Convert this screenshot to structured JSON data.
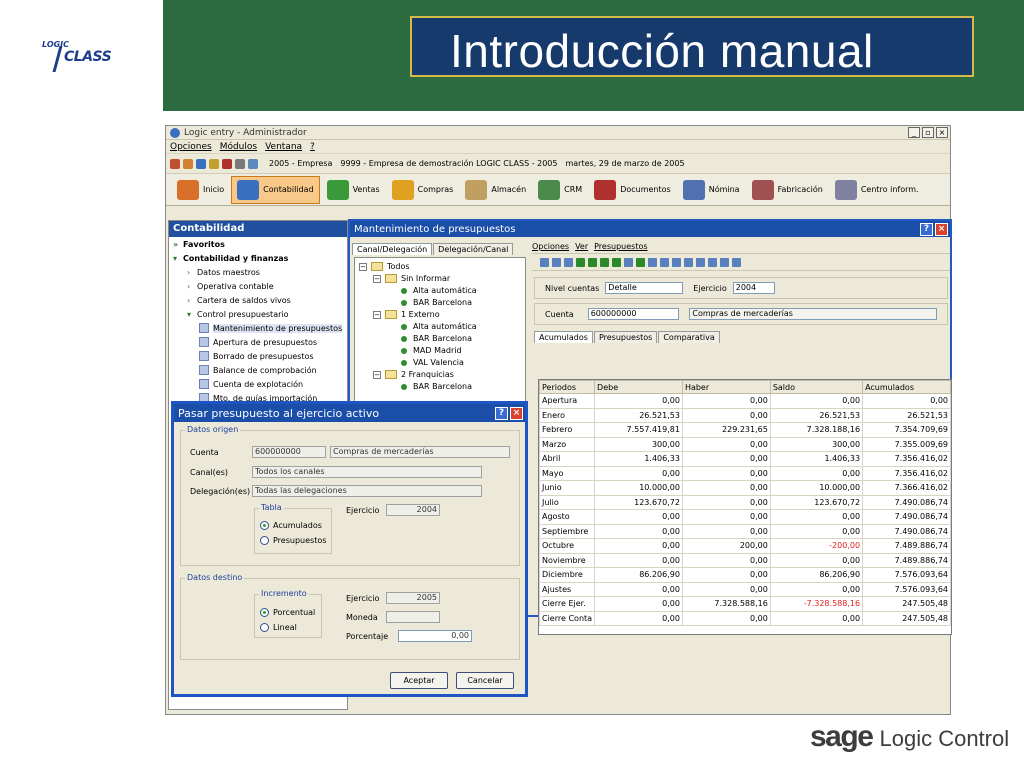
{
  "slide": {
    "title": "Introducción manual",
    "logo_top": "LOGIC",
    "logo_bottom": "CLASS",
    "footer_brand": "sage",
    "footer_product": "Logic Control"
  },
  "app": {
    "window_title": "Logic entry - Administrador",
    "menu": [
      "Opciones",
      "Módulos",
      "Ventana",
      "?"
    ],
    "info_year": "2005 - Empresa",
    "info_company": "9999 - Empresa de demostración LOGIC CLASS - 2005",
    "info_date": "martes, 29 de marzo de 2005",
    "modules": [
      {
        "label": "Inicio",
        "color": "#d9702a"
      },
      {
        "label": "Contabilidad",
        "color": "#3a6fc0"
      },
      {
        "label": "Ventas",
        "color": "#3a9a3a"
      },
      {
        "label": "Compras",
        "color": "#e0a020"
      },
      {
        "label": "Almacén",
        "color": "#c0a060"
      },
      {
        "label": "CRM",
        "color": "#4a8a4a"
      },
      {
        "label": "Documentos",
        "color": "#b03030"
      },
      {
        "label": "Nómina",
        "color": "#5070b0"
      },
      {
        "label": "Fabricación",
        "color": "#a05050"
      },
      {
        "label": "Centro inform.",
        "color": "#8080a0"
      }
    ]
  },
  "nav": {
    "header": "Contabilidad",
    "items": [
      {
        "label": "Favoritos"
      },
      {
        "label": "Contabilidad y finanzas"
      },
      {
        "label": "Datos maestros"
      },
      {
        "label": "Operativa contable"
      },
      {
        "label": "Cartera de saldos vivos"
      },
      {
        "label": "Control presupuestario"
      },
      {
        "label": "Mantenimiento de presupuestos"
      },
      {
        "label": "Apertura de presupuestos"
      },
      {
        "label": "Borrado de presupuestos"
      },
      {
        "label": "Balance de comprobación"
      },
      {
        "label": "Cuenta de explotación"
      },
      {
        "label": "Mto. de guías importación"
      }
    ]
  },
  "mant": {
    "title": "Mantenimiento de presupuestos",
    "tab1": "Canal/Delegación",
    "tab2": "Delegación/Canal",
    "tree": [
      {
        "label": "Todos"
      },
      {
        "label": "Sin Informar"
      },
      {
        "label": "Alta automática"
      },
      {
        "label": "BAR Barcelona"
      },
      {
        "label": "1 Externo"
      },
      {
        "label": "Alta automática"
      },
      {
        "label": "BAR Barcelona"
      },
      {
        "label": "MAD Madrid"
      },
      {
        "label": "VAL Valencia"
      },
      {
        "label": "2 Franquicias"
      },
      {
        "label": "BAR Barcelona"
      }
    ],
    "menu": [
      "Opciones",
      "Ver",
      "Presupuestos"
    ],
    "nivel_label": "Nivel cuentas",
    "nivel_value": "Detalle",
    "ejercicio_label": "Ejercicio",
    "ejercicio_value": "2004",
    "cuenta_label": "Cuenta",
    "cuenta_value": "600000000",
    "cuenta_desc": "Compras de mercaderías",
    "tabs": [
      "Acumulados",
      "Presupuestos",
      "Comparativa"
    ],
    "columns": [
      "Periodos",
      "Debe",
      "Haber",
      "Saldo",
      "Acumulados"
    ],
    "rows": [
      {
        "p": "Apertura",
        "d": "0,00",
        "h": "0,00",
        "s": "0,00",
        "a": "0,00"
      },
      {
        "p": "Enero",
        "d": "26.521,53",
        "h": "0,00",
        "s": "26.521,53",
        "a": "26.521,53"
      },
      {
        "p": "Febrero",
        "d": "7.557.419,81",
        "h": "229.231,65",
        "s": "7.328.188,16",
        "a": "7.354.709,69"
      },
      {
        "p": "Marzo",
        "d": "300,00",
        "h": "0,00",
        "s": "300,00",
        "a": "7.355.009,69"
      },
      {
        "p": "Abril",
        "d": "1.406,33",
        "h": "0,00",
        "s": "1.406,33",
        "a": "7.356.416,02"
      },
      {
        "p": "Mayo",
        "d": "0,00",
        "h": "0,00",
        "s": "0,00",
        "a": "7.356.416,02"
      },
      {
        "p": "Junio",
        "d": "10.000,00",
        "h": "0,00",
        "s": "10.000,00",
        "a": "7.366.416,02"
      },
      {
        "p": "Julio",
        "d": "123.670,72",
        "h": "0,00",
        "s": "123.670,72",
        "a": "7.490.086,74"
      },
      {
        "p": "Agosto",
        "d": "0,00",
        "h": "0,00",
        "s": "0,00",
        "a": "7.490.086,74"
      },
      {
        "p": "Septiembre",
        "d": "0,00",
        "h": "0,00",
        "s": "0,00",
        "a": "7.490.086,74"
      },
      {
        "p": "Octubre",
        "d": "0,00",
        "h": "200,00",
        "s": "-200,00",
        "a": "7.489.886,74"
      },
      {
        "p": "Noviembre",
        "d": "0,00",
        "h": "0,00",
        "s": "0,00",
        "a": "7.489.886,74"
      },
      {
        "p": "Diciembre",
        "d": "86.206,90",
        "h": "0,00",
        "s": "86.206,90",
        "a": "7.576.093,64"
      },
      {
        "p": "Ajustes",
        "d": "0,00",
        "h": "0,00",
        "s": "0,00",
        "a": "7.576.093,64"
      },
      {
        "p": "Cierre Ejer.",
        "d": "0,00",
        "h": "7.328.588,16",
        "s": "-7.328.588,16",
        "a": "247.505,48"
      },
      {
        "p": "Cierre Conta",
        "d": "0,00",
        "h": "0,00",
        "s": "0,00",
        "a": "247.505,48"
      }
    ]
  },
  "dialog": {
    "title": "Pasar presupuesto al ejercicio activo",
    "origen_legend": "Datos origen",
    "cuenta_label": "Cuenta",
    "cuenta_value": "600000000",
    "cuenta_desc": "Compras de mercaderías",
    "canal_label": "Canal(es)",
    "canal_value": "Todos los canales",
    "deleg_label": "Delegación(es)",
    "deleg_value": "Todas las delegaciones",
    "tabla_legend": "Tabla",
    "opt_acumulados": "Acumulados",
    "opt_presupuestos": "Presupuestos",
    "ejercicio_label": "Ejercicio",
    "ejercicio_origen": "2004",
    "destino_legend": "Datos destino",
    "incremento_legend": "Incremento",
    "opt_porcentual": "Porcentual",
    "opt_lineal": "Lineal",
    "ejercicio_destino": "2005",
    "moneda_label": "Moneda",
    "moneda_value": "",
    "porcentaje_label": "Porcentaje",
    "porcentaje_value": "0,00",
    "accept": "Aceptar",
    "cancel": "Cancelar"
  }
}
